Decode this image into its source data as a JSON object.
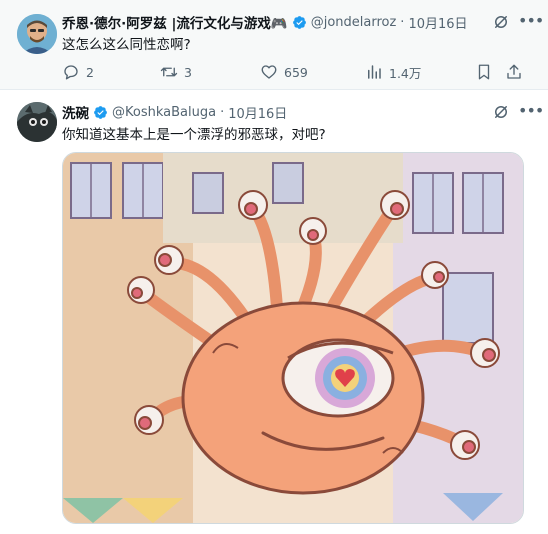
{
  "tweet1": {
    "author_name": "乔恩·德尔·阿罗兹 |流行文化与游戏🎮",
    "handle": "@jondelarroz",
    "separator": "·",
    "date": "10月16日",
    "text": "这怎么这么同性恋啊?",
    "replies": "2",
    "retweets": "3",
    "likes": "659",
    "views": "1.4万"
  },
  "tweet2": {
    "author_name": "洗碗",
    "handle": "@KoshkaBaluga",
    "separator": "·",
    "date": "10月16日",
    "text": "你知道这基本上是一个漂浮的邪恶球，对吧?"
  },
  "colors": {
    "accent": "#1d9bf0",
    "secondary_text": "#536471",
    "highlight_bg": "#f7f9f9"
  },
  "icons": {
    "verified": "verified-badge-icon",
    "grok": "grok-icon",
    "more": "more-icon",
    "reply": "reply-icon",
    "retweet": "retweet-icon",
    "like": "heart-icon",
    "views": "views-icon",
    "bookmark": "bookmark-icon",
    "share": "share-icon"
  }
}
